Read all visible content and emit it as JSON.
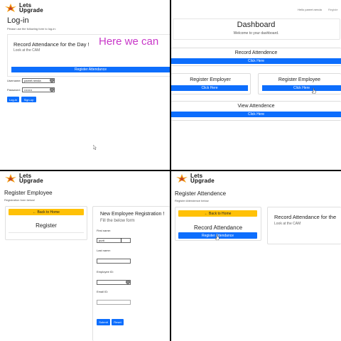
{
  "logo": {
    "line1": "Lets",
    "line2": "Upgrade"
  },
  "login": {
    "title": "Log-in",
    "subtitle": "Please use the following form to log-in:",
    "card_title": "Record Attendance for the Day !",
    "card_sub": "Look at the CAM",
    "overlay": "Here we can",
    "register_btn": "Register Attendance",
    "username_label": "Username:",
    "username_value": "pareet.nenda",
    "password_label": "Password:",
    "password_value": "••••••••",
    "login_btn": "Log-in",
    "signup_btn": "Sign-up"
  },
  "dashboard": {
    "user_greeting": "Hello pareet.nenda",
    "nav_register": "Registe",
    "title": "Dashboard",
    "welcome": "Welcome to your dashboard.",
    "record_title": "Record Attendence",
    "record_btn": "Click Here",
    "reg_employer_title": "Register Employer",
    "reg_employer_btn": "Click Here",
    "reg_employee_title": "Register Employee",
    "reg_employee_btn": "Click Here",
    "view_title": "View Attendence",
    "view_btn": "Click Here"
  },
  "reg_employee": {
    "title": "Register Employee",
    "subtitle": "Registration form below!",
    "back_btn": "← Back to Home",
    "left_card_title": "Register",
    "form_title": "New Employee Registration !",
    "form_sub": "Fill the below form",
    "first_name_label": "First name:",
    "first_name_value": "purit",
    "last_name_label": "Last name:",
    "employee_id_label": "Employee ID:",
    "email_label": "Email ID:",
    "submit_btn": "Submit",
    "reset_btn": "Reset"
  },
  "reg_attendance": {
    "title": "Register Attendence",
    "subtitle": "Register Attendence below",
    "back_btn": "← Back to Home",
    "card_title": "Record Attendance",
    "card_btn": "Register Attendance",
    "right_title": "Record Attendance for the",
    "right_sub": "Look at the CAM"
  },
  "colors": {
    "primary": "#0d6efd",
    "warning": "#ffc107",
    "overlay": "#c837c8"
  }
}
